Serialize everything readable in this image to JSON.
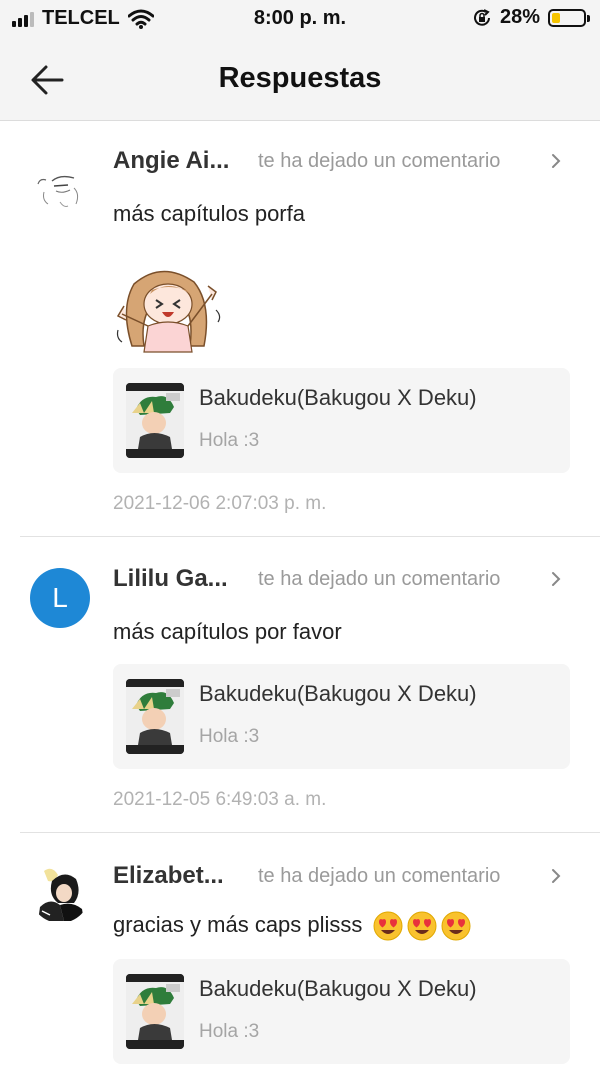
{
  "status_bar": {
    "carrier": "TELCEL",
    "time": "8:00 p. m.",
    "battery_percent": "28%",
    "battery_level": 0.28,
    "battery_color": "#f5c400",
    "icons": [
      "signal-icon",
      "wifi-icon",
      "orientation-lock-icon",
      "battery-icon"
    ]
  },
  "header": {
    "title": "Respuestas",
    "back_icon": "arrow-left-icon"
  },
  "notifications": [
    {
      "user": "Angie Ai...",
      "action": "te ha dejado un comentario",
      "comment": "más capítulos porfa",
      "has_sticker": true,
      "story_title": "Bakudeku(Bakugou X Deku)",
      "story_excerpt": "Hola :3",
      "timestamp": "2021-12-06 2:07:03 p. m."
    },
    {
      "user": "Lililu Ga...",
      "avatar_letter": "L",
      "avatar_color": "#1e88d6",
      "action": "te ha dejado un comentario",
      "comment": "más capítulos por favor",
      "story_title": "Bakudeku(Bakugou X Deku)",
      "story_excerpt": "Hola :3",
      "timestamp": "2021-12-05 6:49:03 a. m."
    },
    {
      "user": "Elizabet...",
      "action": "te ha dejado un comentario",
      "comment": "gracias y más caps plisss",
      "emoji_count": 3,
      "emoji": "heart-eyes-emoji",
      "story_title": "Bakudeku(Bakugou X Deku)",
      "story_excerpt": "Hola :3"
    }
  ]
}
